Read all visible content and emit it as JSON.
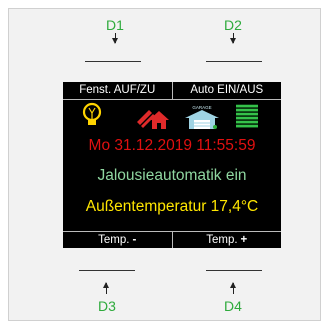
{
  "keys": {
    "d1": "D1",
    "d2": "D2",
    "d3": "D3",
    "d4": "D4"
  },
  "display": {
    "top_left": "Fenst. AUF/ZU",
    "top_right": "Auto EIN/AUS",
    "icons": [
      "light-bulb-icon",
      "window-house-icon",
      "garage-icon",
      "jalousie-icon"
    ],
    "garage_label": "GARAGE",
    "datetime": "Mo 31.12.2019 11:55:59",
    "status": "Jalousieautomatik ein",
    "outside_temp": "Außentemperatur 17,4°C",
    "bottom_left_label": "Temp.",
    "bottom_left_symbol": "-",
    "bottom_right_label": "Temp.",
    "bottom_right_symbol": "+"
  },
  "colors": {
    "key_label": "#2eaa3c",
    "datetime": "#e01010",
    "status": "#8fd6a0",
    "outside_temp": "#ffe600",
    "display_bg": "#000000"
  }
}
